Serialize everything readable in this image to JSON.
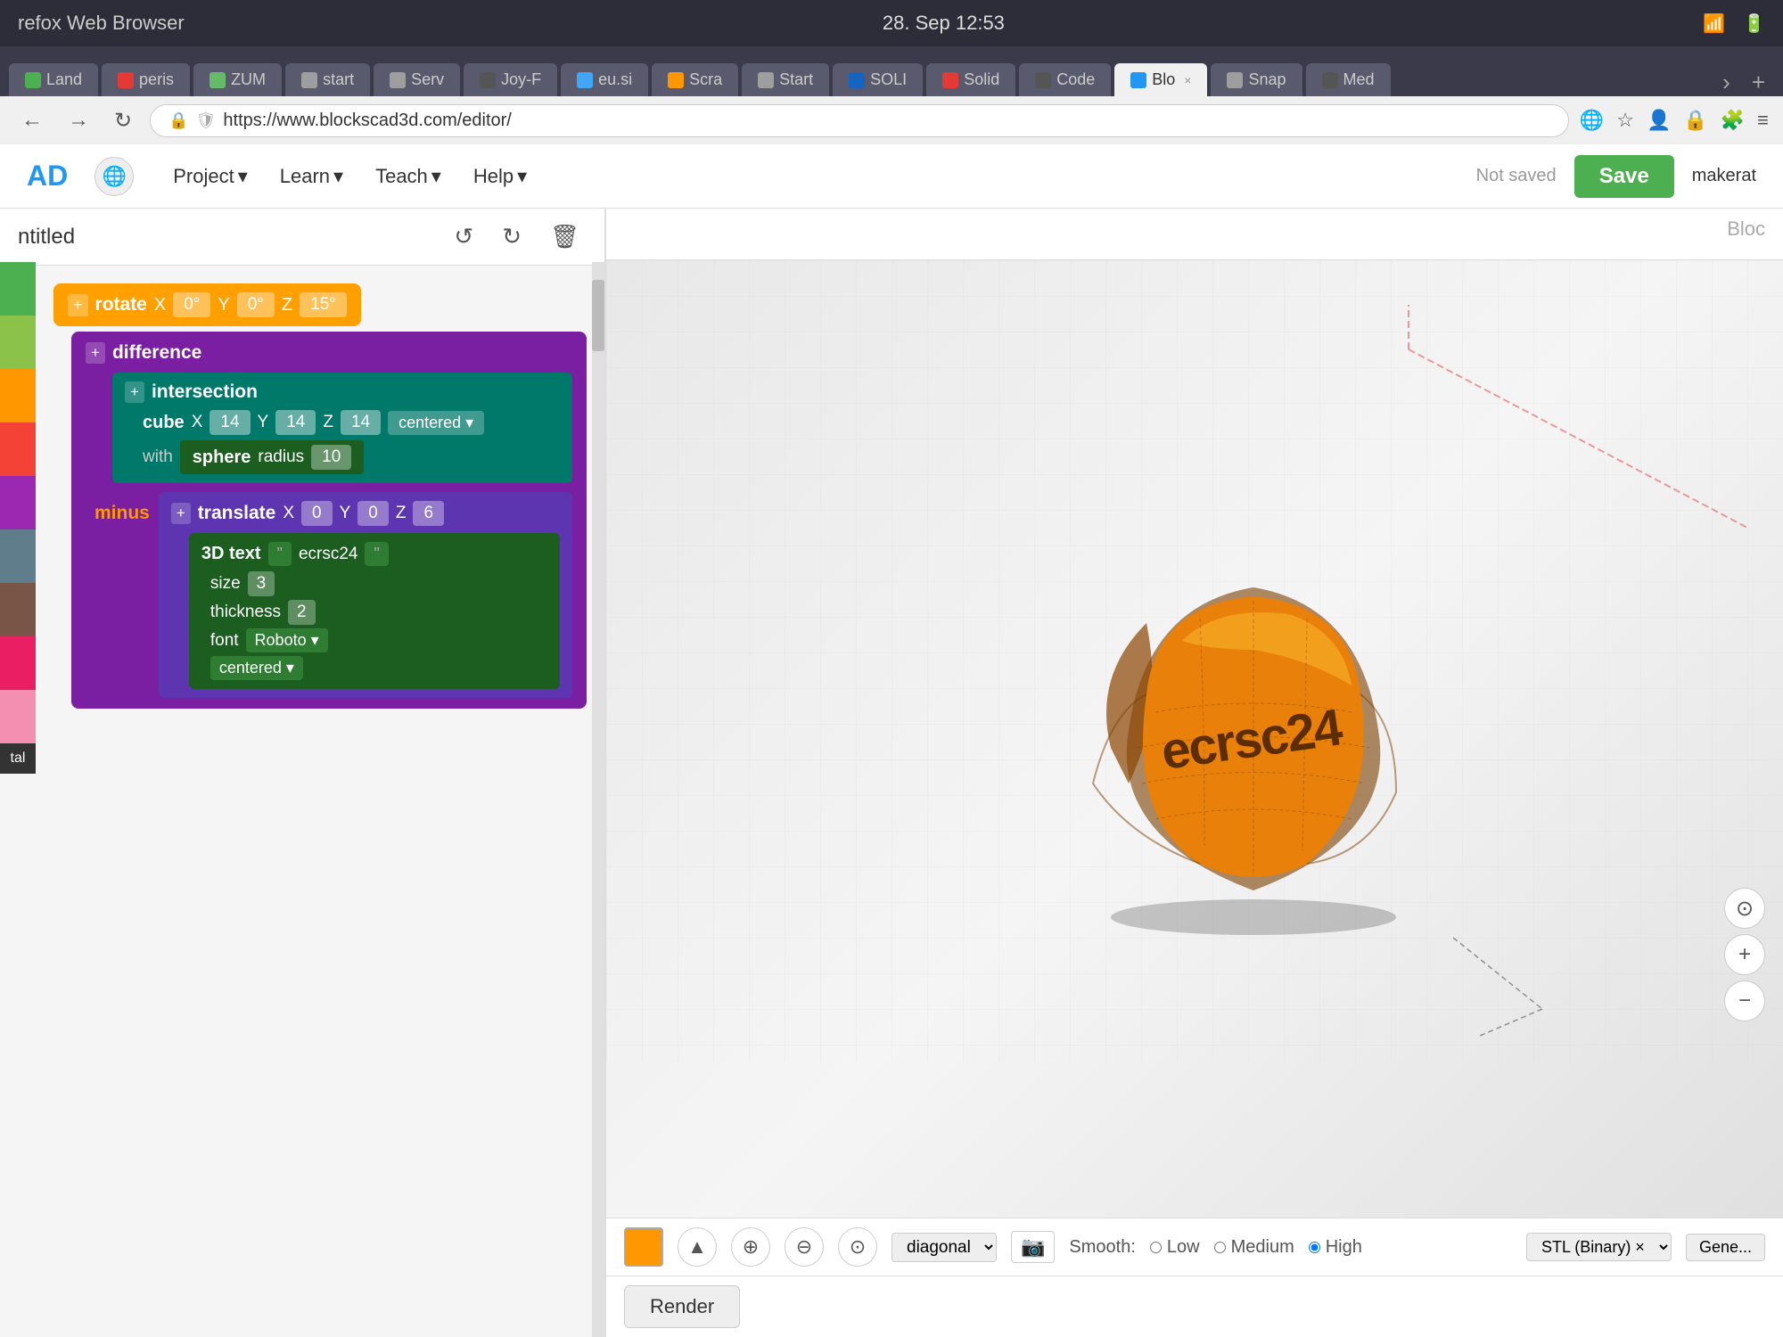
{
  "os": {
    "bar_title": "refox Web Browser",
    "time": "28. Sep 12:53",
    "battery_icon": "🔋"
  },
  "browser": {
    "tabs": [
      {
        "label": "Land",
        "favicon_color": "#4CAF50",
        "active": false
      },
      {
        "label": "peris",
        "favicon_color": "#e53935",
        "active": false
      },
      {
        "label": "ZUM",
        "favicon_color": "#66BB6A",
        "active": false
      },
      {
        "label": "start",
        "favicon_color": "#9E9E9E",
        "active": false
      },
      {
        "label": "Serv",
        "favicon_color": "#9E9E9E",
        "active": false
      },
      {
        "label": "Joy-F",
        "favicon_color": "#555",
        "active": false
      },
      {
        "label": "eu.si",
        "favicon_color": "#42A5F5",
        "active": false
      },
      {
        "label": "Scra",
        "favicon_color": "#FF9800",
        "active": false
      },
      {
        "label": "Start",
        "favicon_color": "#9E9E9E",
        "active": false
      },
      {
        "label": "SOLI",
        "favicon_color": "#1565C0",
        "active": false
      },
      {
        "label": "Solid",
        "favicon_color": "#e53935",
        "active": false
      },
      {
        "label": "Code",
        "favicon_color": "#555",
        "active": false
      },
      {
        "label": "Blo ×",
        "favicon_color": "#2196F3",
        "active": true
      },
      {
        "label": "Snap",
        "favicon_color": "#9E9E9E",
        "active": false
      },
      {
        "label": "Med",
        "favicon_color": "#555",
        "active": false
      }
    ],
    "address": "https://www.blockscad3d.com/editor/",
    "more_tabs_icon": "›"
  },
  "app": {
    "logo": "AD",
    "globe_icon": "🌐",
    "nav": [
      {
        "label": "Project",
        "has_arrow": true
      },
      {
        "label": "Learn",
        "has_arrow": true
      },
      {
        "label": "Teach",
        "has_arrow": true
      },
      {
        "label": "Help",
        "has_arrow": true
      }
    ],
    "not_saved": "Not saved",
    "save_label": "Save",
    "username": "makerat"
  },
  "blocks_panel": {
    "title": "ntitled",
    "undo_icon": "↺",
    "redo_icon": "↻",
    "delete_icon": "🗑",
    "palette_colors": [
      "#4CAF50",
      "#8BC34A",
      "#FF9800",
      "#F44336",
      "#9C27B0",
      "#607D8B",
      "#795548",
      "#E91E63",
      "#F48FB1"
    ],
    "blocks": {
      "rotate_label": "rotate",
      "rotate_x_label": "X",
      "rotate_x_val": "0°",
      "rotate_y_label": "Y",
      "rotate_y_val": "0°",
      "rotate_z_label": "Z",
      "rotate_z_val": "15°",
      "difference_label": "difference",
      "intersection_label": "intersection",
      "cube_label": "cube",
      "cube_x_label": "X",
      "cube_x_val": "14",
      "cube_y_label": "Y",
      "cube_y_val": "14",
      "cube_z_label": "Z",
      "cube_z_val": "14",
      "cube_centered": "centered ▾",
      "with_label": "with",
      "sphere_label": "sphere",
      "sphere_radius_label": "radius",
      "sphere_radius_val": "10",
      "minus_label": "minus",
      "translate_label": "translate",
      "translate_x_label": "X",
      "translate_x_val": "0",
      "translate_y_label": "Y",
      "translate_y_val": "0",
      "translate_z_label": "Z",
      "translate_z_val": "6",
      "text3d_label": "3D text",
      "text3d_value": "ecrsc24",
      "size_label": "size",
      "size_val": "3",
      "thickness_label": "thickness",
      "thickness_val": "2",
      "font_label": "font",
      "font_val": "Roboto ▾",
      "centered_val": "centered ▾"
    }
  },
  "viewport": {
    "panel_label": "Bloc",
    "shape_text": "ecrsc24",
    "color_box": "#FF9800",
    "diagonal_label": "diagonal ▾",
    "smooth_label": "Smooth:",
    "smooth_low": "Low",
    "smooth_medium": "Medium",
    "smooth_high": "High",
    "camera_icon": "📷",
    "zoom_in_icon": "+",
    "zoom_out_icon": "−",
    "center_icon": "⊙",
    "stl_label": "STL (Binary) ×",
    "generate_label": "Gene...",
    "render_label": "Render",
    "triangle_icon": "▲",
    "plus_circle_icon": "⊕",
    "minus_circle_icon": "⊖",
    "radio_icon": "⊙"
  }
}
